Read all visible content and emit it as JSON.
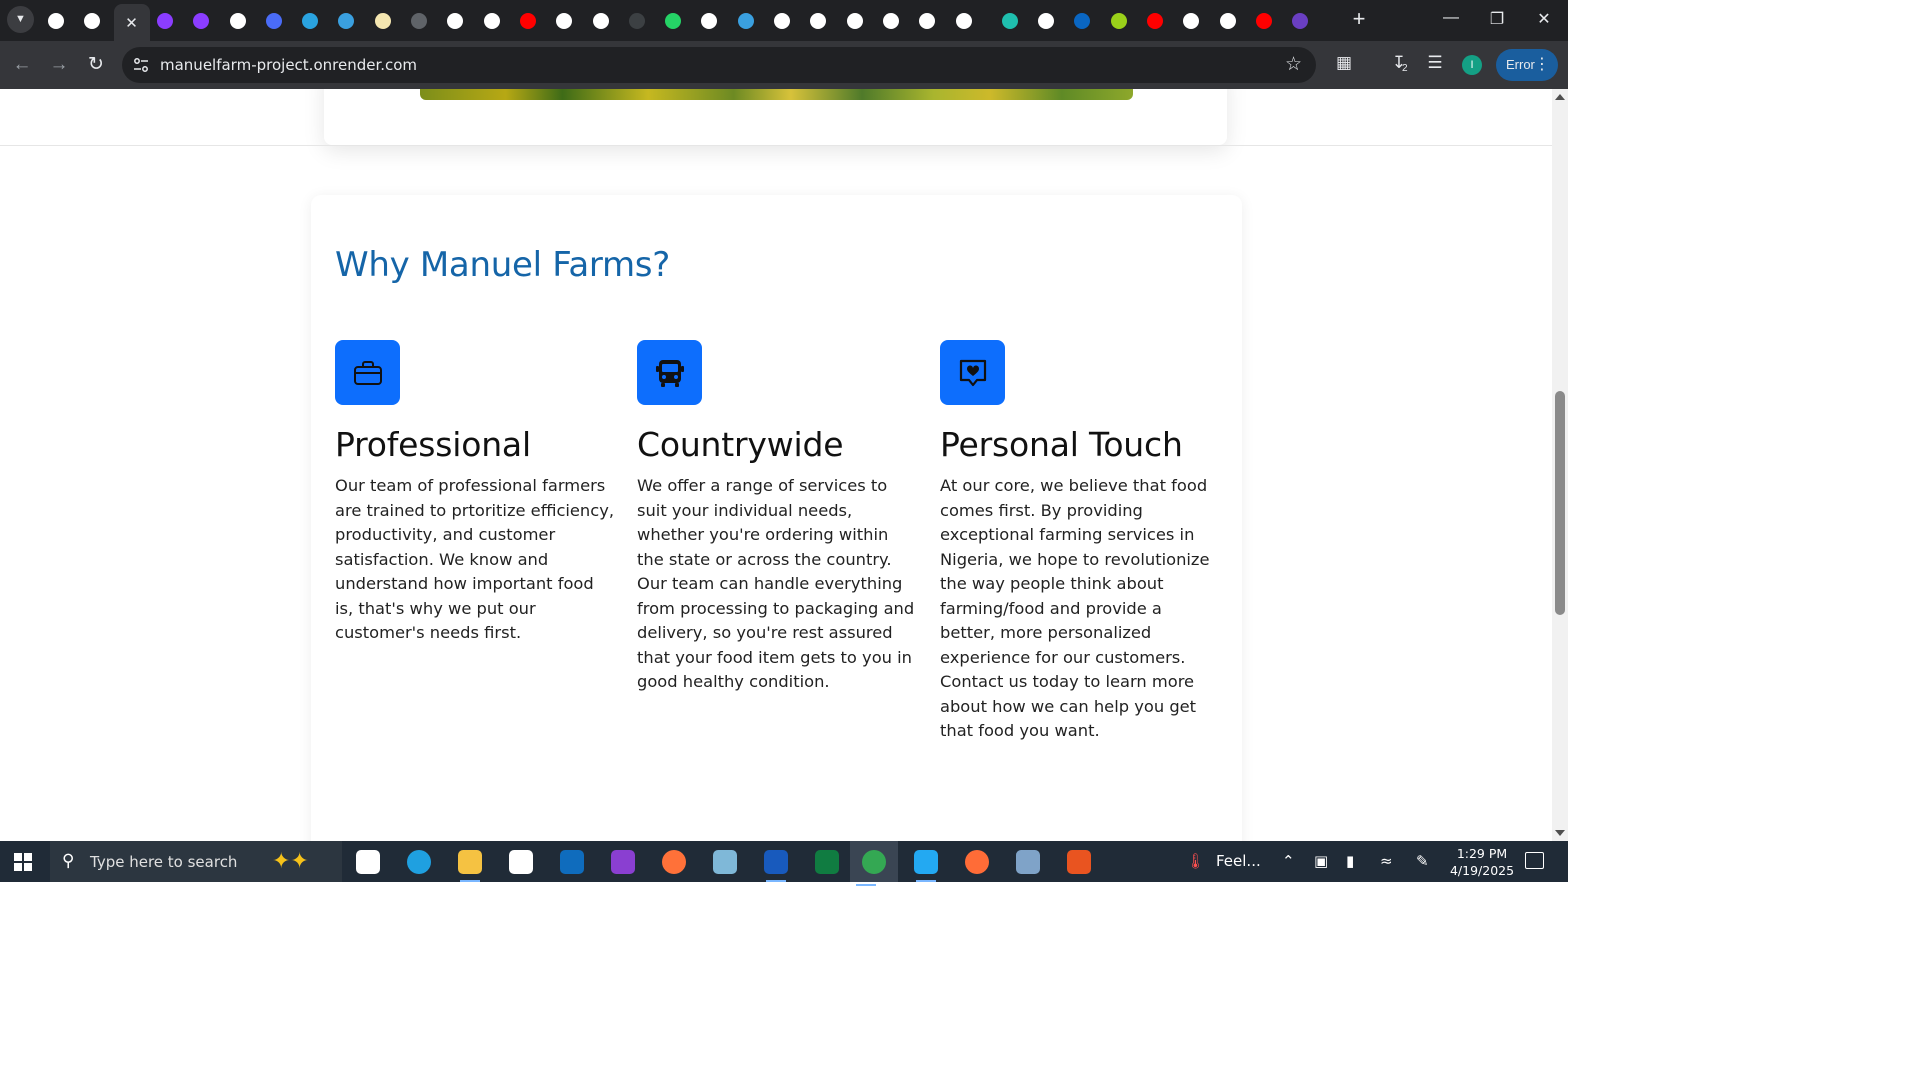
{
  "browser": {
    "tab_menu_icon": "chevron-down-icon",
    "tabs": [
      {
        "icon": "github-icon",
        "color": "#ffffff"
      },
      {
        "icon": "render-icon",
        "color": "#ffffff"
      },
      {
        "icon": "close-icon",
        "color": "#e8eaed",
        "active": true
      },
      {
        "icon": "upwork-icon",
        "color": "#8b3dff"
      },
      {
        "icon": "upwork-icon",
        "color": "#8b3dff"
      },
      {
        "icon": "chatgpt-icon",
        "color": "#ffffff"
      },
      {
        "icon": "vscode-icon",
        "color": "#4a6cf7"
      },
      {
        "icon": "telegram-icon",
        "color": "#2aa3e0"
      },
      {
        "icon": "bird-icon",
        "color": "#3aa0e0"
      },
      {
        "icon": "app-icon",
        "color": "#f4e6b0"
      },
      {
        "icon": "file-icon",
        "color": "#5f6368"
      },
      {
        "icon": "github-icon",
        "color": "#ffffff"
      },
      {
        "icon": "code-icon",
        "color": "#ffffff"
      },
      {
        "icon": "youtube-icon",
        "color": "#ff0000"
      },
      {
        "icon": "github-icon",
        "color": "#ffffff"
      },
      {
        "icon": "github-icon",
        "color": "#ffffff"
      },
      {
        "icon": "file-icon",
        "color": "#3c4043"
      },
      {
        "icon": "whatsapp-icon",
        "color": "#25d366"
      },
      {
        "icon": "globe-icon",
        "color": "#ffffff"
      },
      {
        "icon": "shield-icon",
        "color": "#3aa0e0"
      },
      {
        "icon": "globe-icon",
        "color": "#ffffff"
      },
      {
        "icon": "globe-icon",
        "color": "#ffffff"
      },
      {
        "icon": "globe-icon",
        "color": "#ffffff"
      },
      {
        "icon": "google-icon",
        "color": "#ffffff"
      },
      {
        "icon": "google-icon",
        "color": "#ffffff"
      },
      {
        "icon": "google-icon",
        "color": "#ffffff"
      },
      {
        "icon": "diamond-icon",
        "color": "#1fbfae"
      },
      {
        "icon": "google-icon",
        "color": "#ffffff"
      },
      {
        "icon": "linkedin-icon",
        "color": "#0a66c2"
      },
      {
        "icon": "download-icon",
        "color": "#9ad11a"
      },
      {
        "icon": "youtube-icon",
        "color": "#ff0000"
      },
      {
        "icon": "globe-icon",
        "color": "#ffffff"
      },
      {
        "icon": "google-icon",
        "color": "#ffffff"
      },
      {
        "icon": "youtube-icon",
        "color": "#ff0000"
      },
      {
        "icon": "app-icon",
        "color": "#6a3fc2"
      }
    ],
    "url": "manuelfarm-project.onrender.com",
    "downloads_badge": "2",
    "profile_initial": "I",
    "error_label": "Error"
  },
  "page": {
    "section_title": "Why Manuel Farms?",
    "features": [
      {
        "icon": "briefcase-icon",
        "title": "Professional",
        "text": "Our team of professional farmers are trained to prtoritize efficiency, productivity, and customer satisfaction. We know and understand how important food is, that's why we put our customer's needs first."
      },
      {
        "icon": "bus-icon",
        "title": "Countrywide",
        "text": "We offer a range of services to suit your individual needs, whether you're ordering within the state or across the country. Our team can handle everything from processing to packaging and delivery, so you're rest assured that your food item gets to you in good healthy condition."
      },
      {
        "icon": "chat-heart-icon",
        "title": "Personal Touch",
        "text": "At our core, we believe that food comes first. By providing exceptional farming services in Nigeria, we hope to revolutionize the way people think about farming/food and provide a better, more personalized experience for our customers. Contact us today to learn more about how we can help you get that food you want."
      }
    ],
    "accent_color": "#1565a8",
    "icon_bg_color": "#0d6efd"
  },
  "taskbar": {
    "search_placeholder": "Type here to search",
    "weather_label": "Feel...",
    "time": "1:29 PM",
    "date": "4/19/2025",
    "apps": [
      {
        "icon": "task-view-icon",
        "color": "#ffffff"
      },
      {
        "icon": "edge-icon",
        "color": "#1fa0e0"
      },
      {
        "icon": "file-explorer-icon",
        "color": "#f5c242"
      },
      {
        "icon": "store-icon",
        "color": "#ffffff"
      },
      {
        "icon": "outlook-icon",
        "color": "#0f6cbd"
      },
      {
        "icon": "app-icon",
        "color": "#8a3fd1"
      },
      {
        "icon": "firefox-icon",
        "color": "#ff7139"
      },
      {
        "icon": "app-icon",
        "color": "#7fb8d8"
      },
      {
        "icon": "word-icon",
        "color": "#185abd"
      },
      {
        "icon": "excel-icon",
        "color": "#107c41"
      },
      {
        "icon": "chrome-icon",
        "color": "#34a853"
      },
      {
        "icon": "vscode-icon",
        "color": "#23a9f2"
      },
      {
        "icon": "postman-icon",
        "color": "#ff6c37"
      },
      {
        "icon": "postgres-icon",
        "color": "#7fa3c8"
      },
      {
        "icon": "ubuntu-icon",
        "color": "#e95420"
      }
    ]
  }
}
